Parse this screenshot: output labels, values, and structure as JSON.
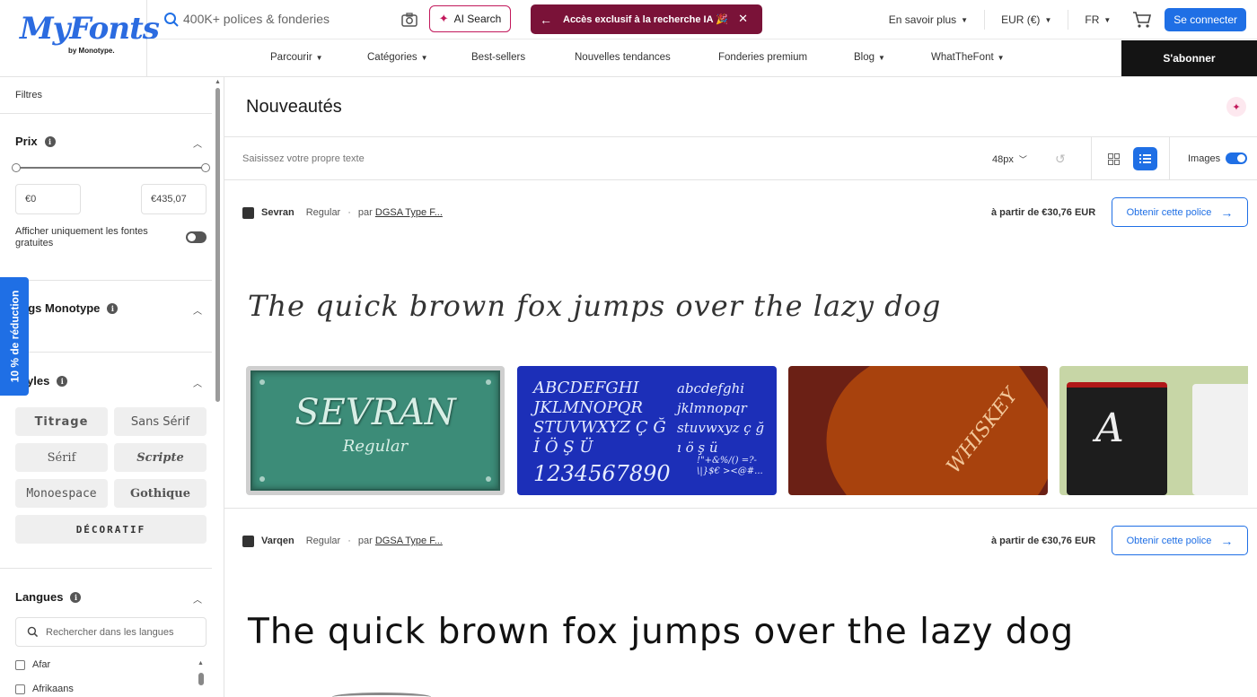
{
  "brand": {
    "logo": "MyFonts",
    "sub": "by Monotype."
  },
  "search": {
    "placeholder": "400K+ polices & fonderies"
  },
  "ai_search_label": "AI Search",
  "promo_banner": "Accès exclusif à la recherche IA 🎉",
  "top_right": {
    "learn_more": "En savoir plus",
    "currency": "EUR (€)",
    "language": "FR",
    "login": "Se connecter"
  },
  "nav": [
    "Parcourir",
    "Catégories",
    "Best-sellers",
    "Nouvelles tendances",
    "Fonderies premium",
    "Blog",
    "WhatTheFont"
  ],
  "subscribe": "S'abonner",
  "sidebar": {
    "filters": "Filtres",
    "price": {
      "title": "Prix",
      "min": "€0",
      "max": "€435,07",
      "free_only": "Afficher uniquement les fontes gratuites"
    },
    "discount_tab": "10 % de réduction",
    "monotype_tags": "Tags Monotype",
    "styles": {
      "title": "Styles",
      "items": [
        "Titrage",
        "Sans Sérif",
        "Sérif",
        "Scripte",
        "Monoespace",
        "Gothique",
        "DÉCORATIF"
      ]
    },
    "languages": {
      "title": "Langues",
      "search_placeholder": "Rechercher dans les langues",
      "items": [
        "Afar",
        "Afrikaans"
      ]
    }
  },
  "main": {
    "title": "Nouveautés",
    "custom_text_placeholder": "Saisissez votre propre texte",
    "size": "48px",
    "images_label": "Images",
    "fonts": [
      {
        "name": "Sevran",
        "style": "Regular",
        "by": "par",
        "foundry": "DGSA Type F...",
        "price": "à partir de €30,76 EUR",
        "cta": "Obtenir cette police",
        "sample": "The quick brown fox jumps over the lazy dog",
        "images": {
          "plate_title": "SEVRAN",
          "plate_sub": "Regular",
          "charset_upper": "ABCDEFGHI JKLMNOPQR STUVWXYZ Ç Ğ İ Ö Ş Ü",
          "charset_lower": "abcdefghi jklmnopqr stuvwxyz ç ğ ı ö ş ü",
          "digits": "1234567890",
          "symbols": "!\"+&%/() =?-\\|}$€ ><@#...",
          "bottle_text": "WHISKEY",
          "mug_text": "A"
        }
      },
      {
        "name": "Varqen",
        "style": "Regular",
        "by": "par",
        "foundry": "DGSA Type F...",
        "price": "à partir de €30,76 EUR",
        "cta": "Obtenir cette police",
        "sample": "The quick brown fox jumps over the lazy dog"
      }
    ]
  },
  "colors": {
    "primary": "#1f6fe5",
    "promo": "#7a1238",
    "ai_accent": "#c2185b",
    "dark": "#141414"
  }
}
